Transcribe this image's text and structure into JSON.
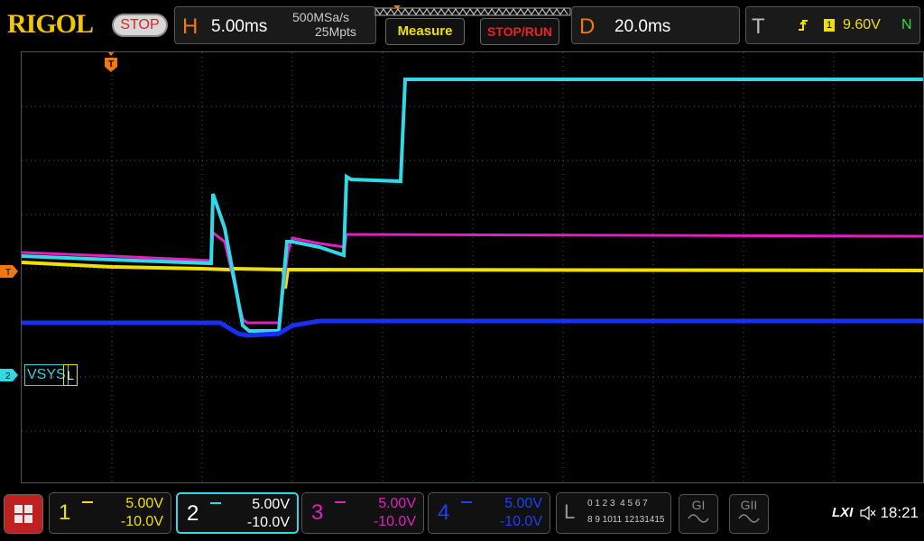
{
  "brand": "RIGOL",
  "run_status": "STOP",
  "horizontal": {
    "letter": "H",
    "timebase": "5.00ms",
    "sample_rate": "500MSa/s",
    "memory_depth": "25Mpts"
  },
  "menu": {
    "measure_label": "Measure",
    "stoprun_label": "STOP/RUN"
  },
  "delay": {
    "letter": "D",
    "value": "20.0ms"
  },
  "trigger": {
    "letter": "T",
    "source_channel": "1",
    "level": "9.60V",
    "mode": "N"
  },
  "waveform_labels": {
    "channel_label": "VSYS",
    "label_suffix": "L",
    "trigger_marker": "T",
    "channel2_marker": "2"
  },
  "channels": [
    {
      "number": "1",
      "scale": "5.00V",
      "offset": "-10.0V",
      "color": "#f0e000"
    },
    {
      "number": "2",
      "scale": "5.00V",
      "offset": "-10.0V",
      "color": "#30d8e8"
    },
    {
      "number": "3",
      "scale": "5.00V",
      "offset": "-10.0V",
      "color": "#e020c0"
    },
    {
      "number": "4",
      "scale": "5.00V",
      "offset": "-10.0V",
      "color": "#1830f0"
    }
  ],
  "logic": {
    "letter": "L",
    "row1": "0 1 2 3  4 5 6 7",
    "row2": "8 9 1011 12131415"
  },
  "generators": {
    "g1": "GI",
    "g2": "GII"
  },
  "status": {
    "lxi": "LXI",
    "time": "18:21"
  }
}
